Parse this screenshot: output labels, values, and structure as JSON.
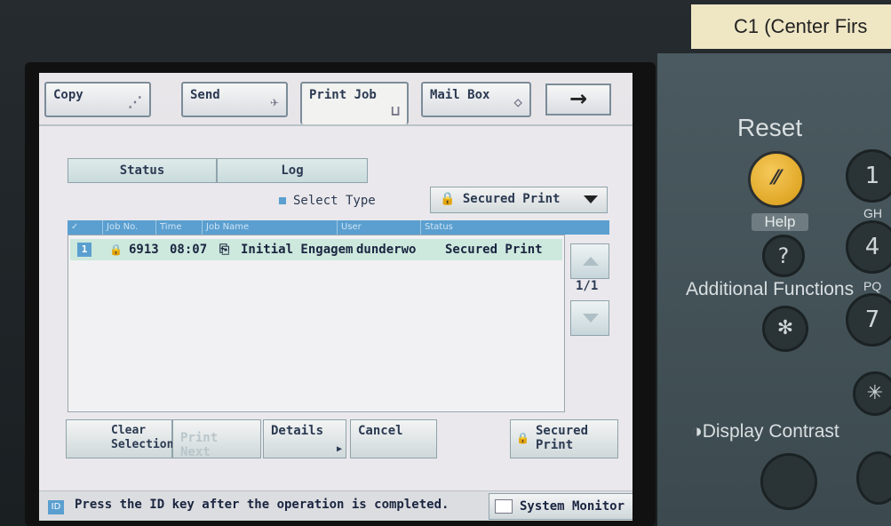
{
  "tabs": [
    {
      "label": "Copy",
      "icon": "copy-icon"
    },
    {
      "label": "Send",
      "icon": "send-icon"
    },
    {
      "label": "Print Job",
      "icon": "print-icon",
      "active": true
    },
    {
      "label": "Mail Box",
      "icon": "mailbox-icon"
    }
  ],
  "arrow": "→",
  "segments": {
    "status": "Status",
    "log": "Log"
  },
  "select_type_label": "Select Type",
  "dropdown_value": "Secured Print",
  "columns": [
    "Job No.",
    "Time",
    "Job Name",
    "User",
    "Status"
  ],
  "rows": [
    {
      "index": "1",
      "job_no": "6913",
      "time": "08:07",
      "job_name": "Initial Engagem",
      "user": "dunderwo",
      "status": "Secured Print"
    }
  ],
  "page_indicator": "1/1",
  "buttons": {
    "clear_selection": "Clear Selection",
    "print_next": "Print Next",
    "details": "Details",
    "cancel": "Cancel",
    "secured_print": "Secured Print"
  },
  "status_message": "Press the ID key after the operation is completed.",
  "id_badge": "ID",
  "system_monitor": "System Monitor",
  "hardware": {
    "label_strip": "C1 (Center Firs",
    "reset": "Reset",
    "help": "Help",
    "additional_functions": "Additional Functions",
    "display_contrast": "Display Contrast",
    "key_1": "1",
    "key_4": "4",
    "key_7": "7",
    "key_gh": "GH",
    "key_pq": "PQ"
  },
  "colors": {
    "accent": "#5a9fd0",
    "row_highlight": "#cde8dd",
    "reset": "#e0a820"
  }
}
